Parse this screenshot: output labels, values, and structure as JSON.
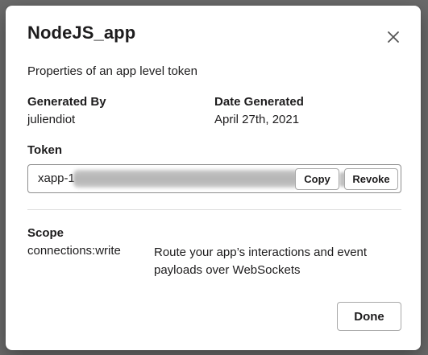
{
  "dialog": {
    "title": "NodeJS_app",
    "subtitle": "Properties of an app level token",
    "generated_by": {
      "label": "Generated By",
      "value": "juliendiot"
    },
    "date_generated": {
      "label": "Date Generated",
      "value": "April 27th, 2021"
    },
    "token": {
      "label": "Token",
      "prefix": "xapp-1",
      "copy_label": "Copy",
      "revoke_label": "Revoke"
    },
    "scope": {
      "label": "Scope",
      "name": "connections:write",
      "description": "Route your app’s interactions and event payloads over WebSockets"
    },
    "done_label": "Done"
  },
  "icons": {
    "close": "close-icon"
  },
  "colors": {
    "backdrop": "#6a6a6a",
    "modal_bg": "#ffffff",
    "text": "#1d1c1d",
    "border": "#8d8d8d",
    "divider": "#dcdcdc"
  }
}
